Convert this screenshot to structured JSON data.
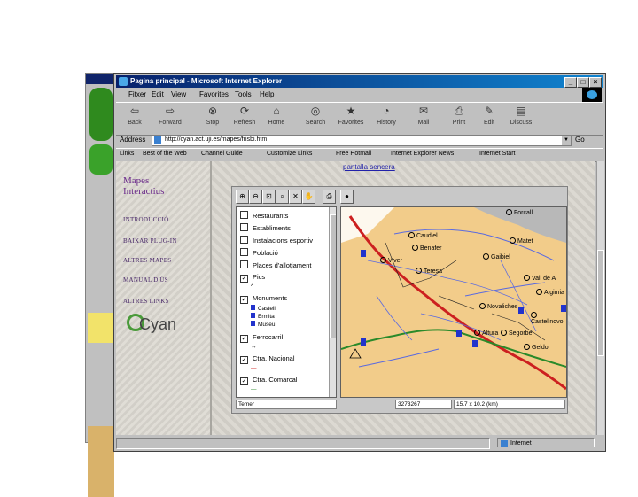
{
  "window": {
    "title": "Pagina principal - Microsoft Internet Explorer",
    "controls": [
      "_",
      "□",
      "×"
    ]
  },
  "menu": [
    "Fitxer",
    "Edit",
    "View",
    "Favorites",
    "Tools",
    "Help"
  ],
  "toolbar": [
    {
      "icon": "back-icon",
      "label": "Back"
    },
    {
      "icon": "forward-icon",
      "label": "Forward"
    },
    {
      "icon": "stop-icon",
      "label": "Stop"
    },
    {
      "icon": "refresh-icon",
      "label": "Refresh"
    },
    {
      "icon": "home-icon",
      "label": "Home"
    },
    {
      "icon": "search-icon",
      "label": "Search"
    },
    {
      "icon": "favorites-icon",
      "label": "Favorites"
    },
    {
      "icon": "history-icon",
      "label": "History"
    },
    {
      "icon": "mail-icon",
      "label": "Mail"
    },
    {
      "icon": "print-icon",
      "label": "Print"
    },
    {
      "icon": "edit-icon",
      "label": "Edit"
    },
    {
      "icon": "discuss-icon",
      "label": "Discuss"
    }
  ],
  "address": {
    "label": "Address",
    "url": "http://cyan.act.uji.es/mapes/frisbi.htm",
    "go": "Go"
  },
  "links": [
    "Links",
    "Best of the Web",
    "Channel Guide",
    "Customize Links",
    "Free Hotmail",
    "Internet Explorer News",
    "Internet Start"
  ],
  "left_frame": {
    "title_line1": "Mapes",
    "title_line2": "Interactius",
    "nav": [
      "INTRODUCCIÓ",
      "BAIXAR PLUG-IN",
      "ALTRES MAPES",
      "MANUAL D'ÚS",
      "ALTRES LINKS"
    ],
    "logo": "yan"
  },
  "right_frame": {
    "pantalla_link": "pantalla sencera",
    "layers": [
      {
        "label": "Restaurants",
        "checked": ""
      },
      {
        "label": "Establiments",
        "checked": ""
      },
      {
        "label": "Instalacions esportiv",
        "checked": ""
      },
      {
        "label": "Població",
        "checked": ""
      },
      {
        "label": "Places d'allotjament",
        "checked": ""
      },
      {
        "label": "Pics",
        "checked": "✓"
      },
      {
        "label": "Monuments",
        "checked": "✓"
      },
      {
        "label": "Ferrocarril",
        "checked": "✓"
      },
      {
        "label": "Ctra. Nacional",
        "checked": "✓"
      },
      {
        "label": "Ctra. Comarcal",
        "checked": "✓"
      }
    ],
    "monument_types": [
      "Castell",
      "Ermita",
      "Museu"
    ],
    "towns": [
      "Forcall",
      "Caudiel",
      "Benafer",
      "Viver",
      "Teresa",
      "Gaibiel",
      "Matet",
      "Vall de A",
      "Algimia",
      "Novaliches",
      "Castellnovo",
      "Altura",
      "Segorbe",
      "Geldo"
    ],
    "status": {
      "left": "Temer",
      "mid": "3273267",
      "right": "15.7 x 10.2 (km)"
    }
  },
  "statusbar": {
    "zone": "Internet"
  }
}
